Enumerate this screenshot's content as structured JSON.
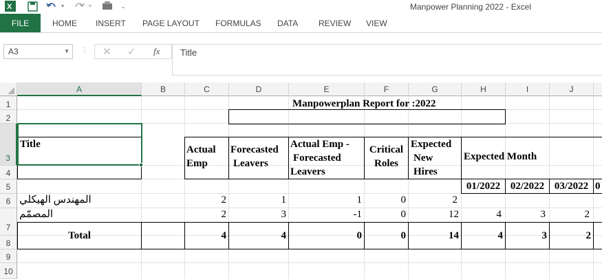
{
  "app": {
    "title": "Manpower Planning 2022 - Excel"
  },
  "ribbon": {
    "tabs": [
      "FILE",
      "HOME",
      "INSERT",
      "PAGE LAYOUT",
      "FORMULAS",
      "DATA",
      "REVIEW",
      "VIEW"
    ]
  },
  "formula_bar": {
    "name_box": "A3",
    "fx_label": "fx",
    "formula": "Title"
  },
  "columns": [
    "A",
    "B",
    "C",
    "D",
    "E",
    "F",
    "G",
    "H",
    "I",
    "J"
  ],
  "rows": [
    "1",
    "2",
    "3",
    "4",
    "5",
    "6",
    "7",
    "8",
    "9",
    "10"
  ],
  "sheet": {
    "report_title": "Manpowerplan Report for :2022",
    "headers": {
      "title": "Title",
      "actual_emp_l1": "Actual",
      "actual_emp_l2": "Emp",
      "forecasted_l1": "Forecasted",
      "forecasted_l2": "Leavers",
      "diff_l1": "Actual Emp -",
      "diff_l2": "Forecasted",
      "diff_l3": "Leavers",
      "critical_l1": "Critical",
      "critical_l2": "Roles",
      "expected_l1": "Expected",
      "expected_l2": "New",
      "expected_l3": "Hires",
      "expected_month": "Expected Month"
    },
    "months": [
      "01/2022",
      "02/2022",
      "03/2022"
    ],
    "row5": {
      "title": "المهندس الهيكلي",
      "actual": "2",
      "forecasted": "1",
      "diff": "1",
      "critical": "0",
      "hires": "2"
    },
    "row6": {
      "title": "المصمّم",
      "actual": "2",
      "forecasted": "3",
      "diff": "-1",
      "critical": "0",
      "hires": "12",
      "m1": "4",
      "m2": "3",
      "m3": "2"
    },
    "total": {
      "label": "Total",
      "actual": "4",
      "forecasted": "4",
      "diff": "0",
      "critical": "0",
      "hires": "14",
      "m1": "4",
      "m2": "3",
      "m3": "2"
    }
  }
}
